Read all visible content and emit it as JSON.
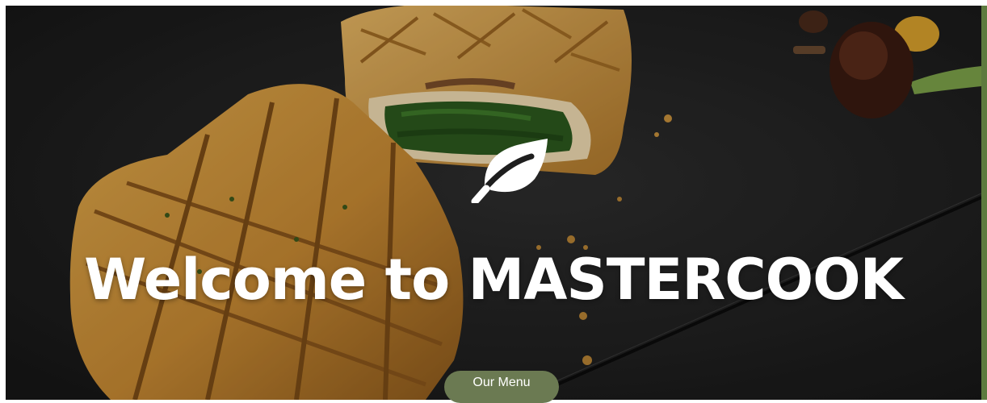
{
  "hero": {
    "logo_icon": "leaf-icon",
    "title": "Welcome to MASTERCOOK",
    "cta_label": "Our Menu"
  },
  "colors": {
    "background": "#1c1c1c",
    "title": "#ffffff",
    "button": "#6b7a52",
    "button_text": "#ffffff",
    "edge_accent": "#5d7a3e"
  }
}
